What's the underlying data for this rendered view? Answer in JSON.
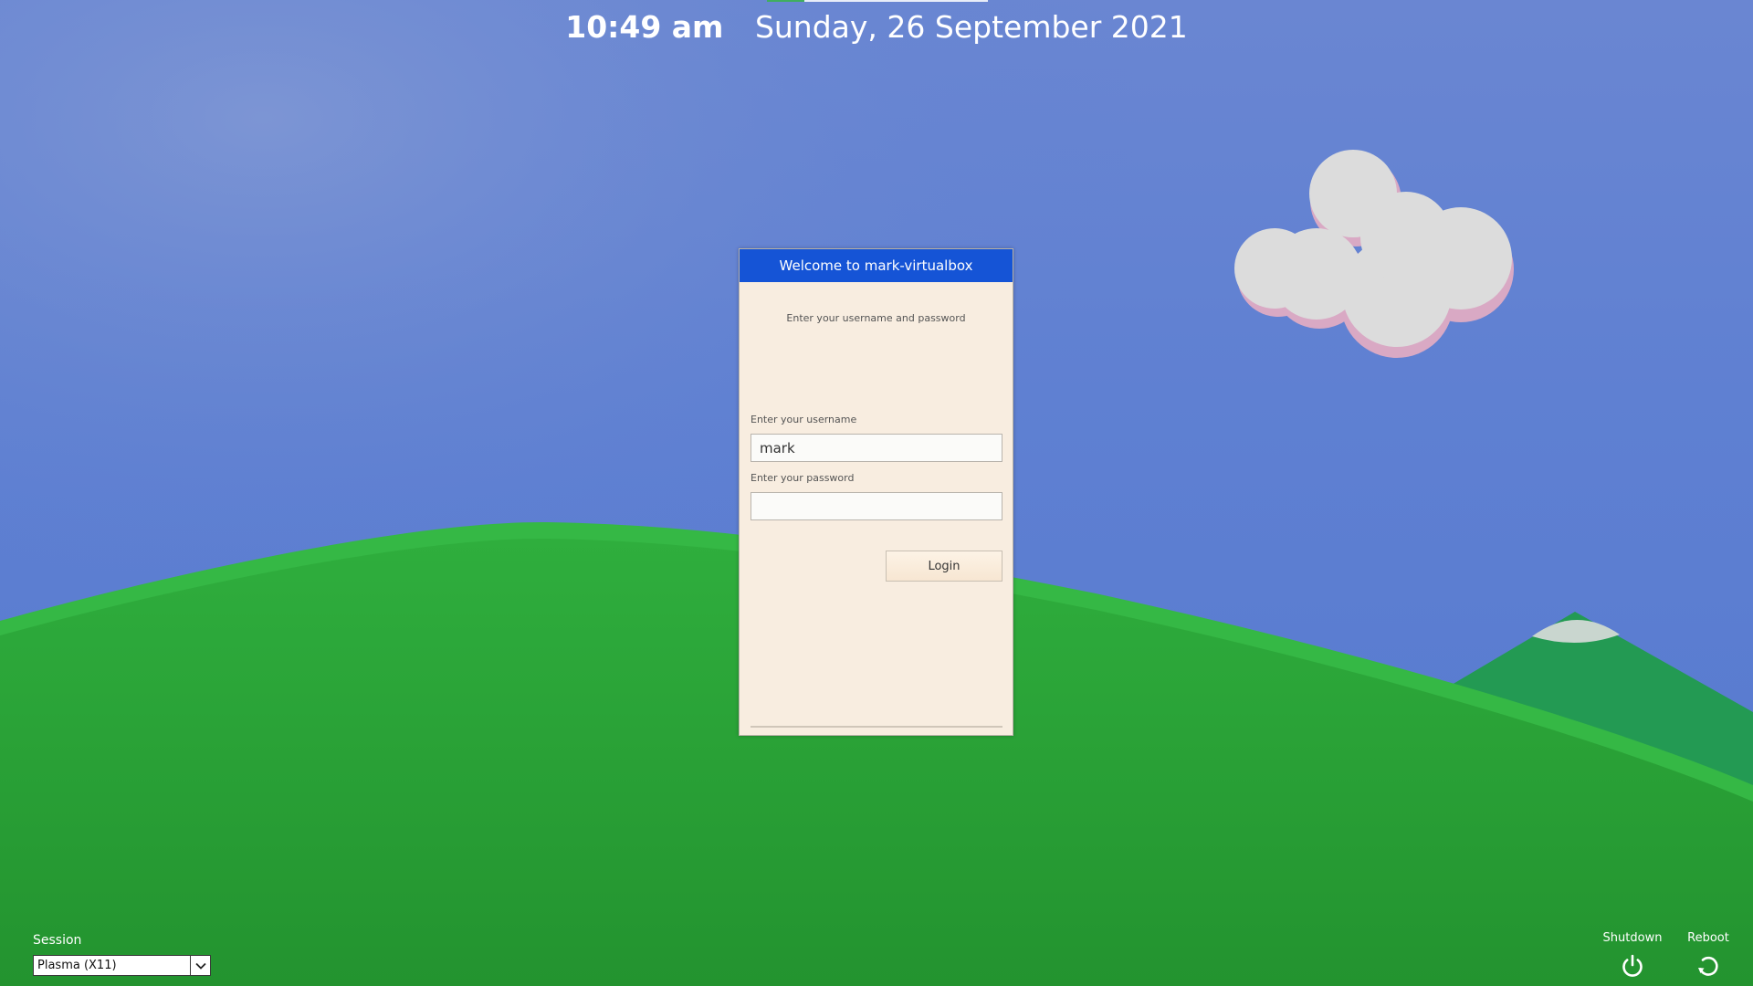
{
  "clock": {
    "time": "10:49 am",
    "date": "Sunday, 26 September 2021"
  },
  "login_dialog": {
    "title": "Welcome to mark-virtualbox",
    "subtitle": "Enter your username and password",
    "username_label": "Enter your username",
    "username_value": "mark",
    "password_label": "Enter your password",
    "password_value": "",
    "login_button": "Login"
  },
  "session": {
    "label": "Session",
    "selected": "Plasma (X11)"
  },
  "power": {
    "shutdown_label": "Shutdown",
    "reboot_label": "Reboot"
  },
  "icons": {
    "shutdown": "power-icon",
    "reboot": "reboot-icon",
    "session_dropdown": "chevron-down-icon"
  },
  "colors": {
    "sky": "#5f80d2",
    "hill": "#2aa33a",
    "dialog_header": "#1554d6",
    "dialog_body": "#f8ede0"
  }
}
